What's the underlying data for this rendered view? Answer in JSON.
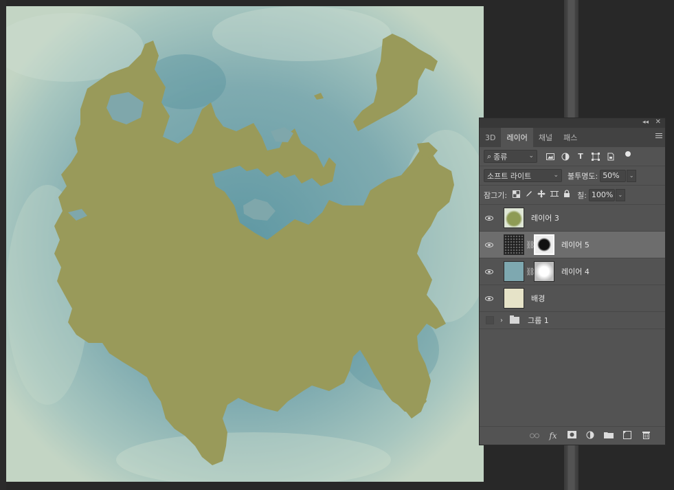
{
  "panel": {
    "tabs": [
      {
        "label": "3D"
      },
      {
        "label": "레이어"
      },
      {
        "label": "채널"
      },
      {
        "label": "패스"
      }
    ],
    "collapse_glyph": "◂◂",
    "close_glyph": "✕",
    "filter": {
      "search_glyph": "⌕",
      "kind_label": "종류"
    },
    "blend": {
      "mode": "소프트 라이트",
      "opacity_label": "불투명도:",
      "opacity_value": "50%"
    },
    "lock": {
      "label": "잠그기:",
      "fill_label": "칠:",
      "fill_value": "100%"
    },
    "layers": [
      {
        "name": "레이어 3",
        "visible": true
      },
      {
        "name": "레이어 5",
        "visible": true,
        "selected": true
      },
      {
        "name": "레이어 4",
        "visible": true
      },
      {
        "name": "배경",
        "visible": true
      }
    ],
    "group": {
      "name": "그룹 1",
      "visible": false
    },
    "bottom_icons": [
      "link-icon",
      "fx-icon",
      "mask-icon",
      "adjustment-icon",
      "folder-icon",
      "new-layer-icon",
      "trash-icon"
    ],
    "fx_label": "fx"
  },
  "colors": {
    "land": "#999a5a",
    "water": "#7fa7ab",
    "panel": "#535353",
    "selected_row": "#6d6d6d"
  }
}
